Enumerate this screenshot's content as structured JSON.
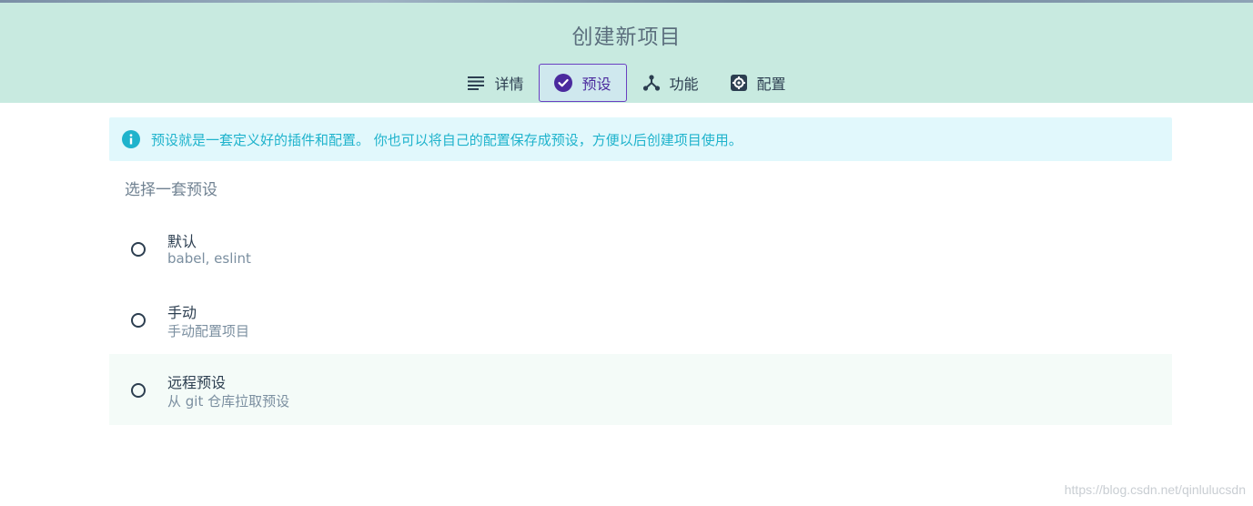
{
  "header": {
    "title": "创建新项目",
    "tabs": [
      {
        "label": "详情",
        "icon": "list-icon"
      },
      {
        "label": "预设",
        "icon": "check-circle-icon",
        "active": true
      },
      {
        "label": "功能",
        "icon": "fork-icon"
      },
      {
        "label": "配置",
        "icon": "gear-icon"
      }
    ]
  },
  "info": {
    "icon": "info-icon",
    "text": "预设就是一套定义好的插件和配置。 你也可以将自己的配置保存成预设，方便以后创建项目使用。"
  },
  "presets": {
    "title": "选择一套预设",
    "items": [
      {
        "name": "默认",
        "description": "babel, eslint"
      },
      {
        "name": "手动",
        "description": "手动配置项目"
      },
      {
        "name": "远程预设",
        "description": "从 git 仓库拉取预设"
      }
    ]
  },
  "watermark": "https://blog.csdn.net/qinlulucsdn",
  "colors": {
    "header_bg": "#c8eae0",
    "accent": "#6a3fc1",
    "info_text": "#1fb3cc",
    "info_bg": "#e1f8fc"
  }
}
